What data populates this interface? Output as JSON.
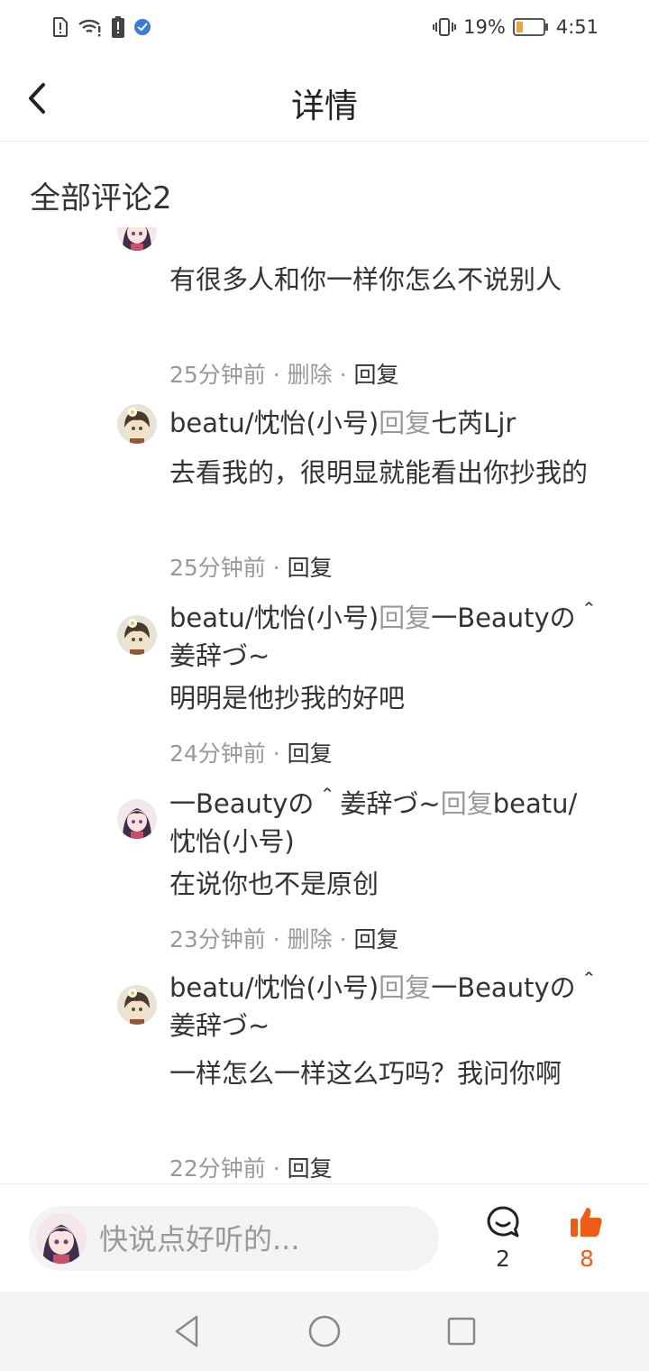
{
  "status_bar": {
    "left_icons": [
      "sim-alert-icon",
      "wifi-alert-icon",
      "battery-alert-icon",
      "app-notification-icon"
    ],
    "battery_percent": "19%",
    "time": "4:51"
  },
  "header": {
    "title": "详情"
  },
  "comments_section": {
    "title": "全部评论2"
  },
  "replies": [
    {
      "text": "有很多人和你一样你怎么不说别人",
      "time": "25分钟前",
      "actions": [
        "删除",
        "回复"
      ]
    },
    {
      "user": "beatu/忱怡(小号)",
      "reply_word": "回复",
      "target": "七芮Ljr",
      "text": "去看我的，很明显就能看出你抄我的",
      "time": "25分钟前",
      "actions": [
        "回复"
      ]
    },
    {
      "user": "beatu/忱怡(小号)",
      "reply_word": "回复",
      "target": "一Beautyの＾姜辞づ~",
      "text": "明明是他抄我的好吧",
      "time": "24分钟前",
      "actions": [
        "回复"
      ]
    },
    {
      "user": "一Beautyの＾姜辞づ~",
      "reply_word": "回复",
      "target": "beatu/忱怡(小号)",
      "text": "在说你也不是原创",
      "time": "23分钟前",
      "actions": [
        "删除",
        "回复"
      ]
    },
    {
      "user": "beatu/忱怡(小号)",
      "reply_word": "回复",
      "target": "一Beautyの＾姜辞づ~",
      "text": "一样怎么一样这么巧吗？我问你啊",
      "time": "22分钟前",
      "actions": [
        "回复"
      ]
    }
  ],
  "meta_separator": "·",
  "bottom_bar": {
    "input_placeholder": "快说点好听的...",
    "comment_count": "2",
    "like_count": "8"
  },
  "colors": {
    "accent": "#ee5d16",
    "secondary_text": "#999999",
    "primary_text": "#333333"
  }
}
